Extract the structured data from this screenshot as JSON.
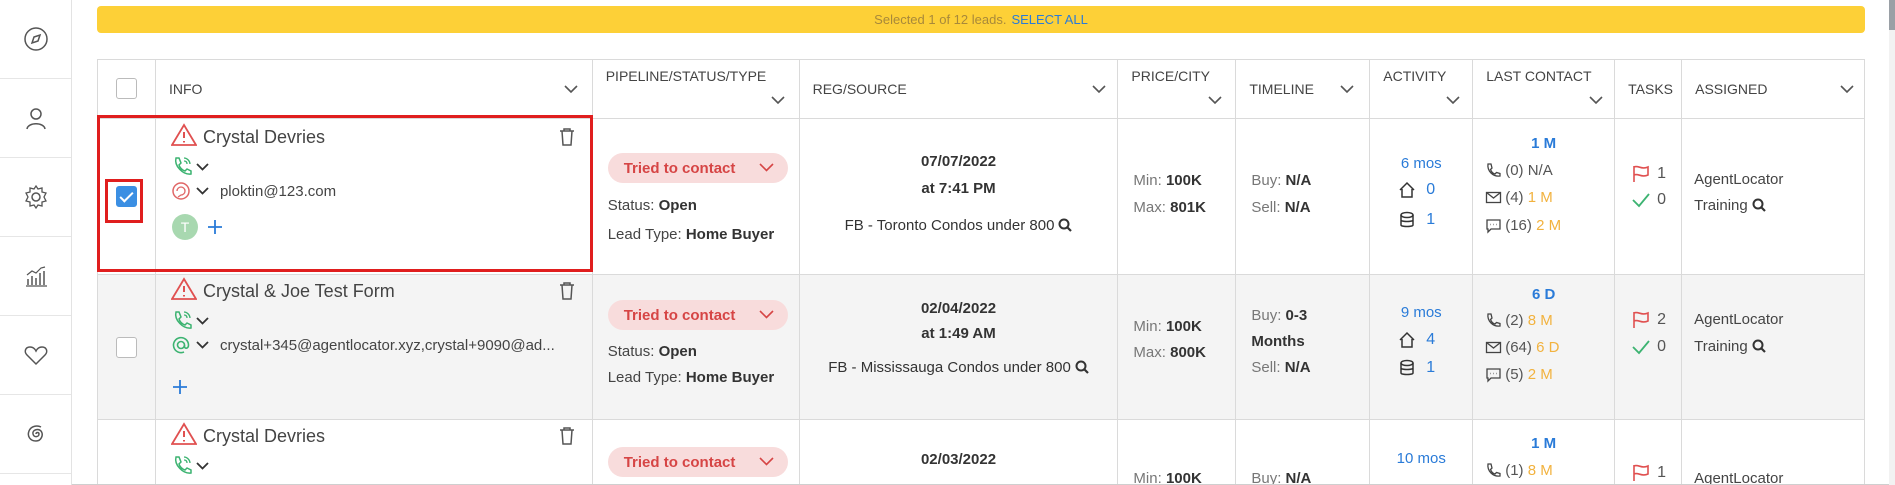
{
  "sidebar": {
    "items": [
      {
        "icon": "compass-icon"
      },
      {
        "icon": "user-icon"
      },
      {
        "icon": "gear-icon"
      },
      {
        "icon": "analytics-icon"
      },
      {
        "icon": "heart-icon"
      },
      {
        "icon": "spiral-icon"
      }
    ]
  },
  "selection": {
    "text": "Selected 1 of 12 leads.",
    "select_all": "SELECT ALL"
  },
  "columns": {
    "info": "INFO",
    "pipeline": "PIPELINE/STATUS/TYPE",
    "reg": "REG/SOURCE",
    "price": "PRICE/CITY",
    "timeline": "TIMELINE",
    "activity": "ACTIVITY",
    "last_contact": "LAST CONTACT",
    "tasks": "TASKS",
    "assigned": "ASSIGNED"
  },
  "labels": {
    "status": "Status:",
    "lead_type": "Lead Type:",
    "min": "Min:",
    "max": "Max:",
    "buy": "Buy:",
    "sell": "Sell:"
  },
  "rows": [
    {
      "selected": true,
      "name": "Crystal Devries",
      "email": "ploktin@123.com",
      "avatar": "T",
      "pipeline": "Tried to contact",
      "status": "Open",
      "lead_type": "Home Buyer",
      "reg_date": "07/07/2022",
      "reg_time": "at 7:41 PM",
      "source": "FB - Toronto Condos under 800",
      "min": "100K",
      "max": "801K",
      "buy": "N/A",
      "sell": "N/A",
      "activity_time": "6 mos",
      "activity_homes": "0",
      "activity_db": "1",
      "lc_top": "1 M",
      "lc_calls": "(0) N/A",
      "lc_calls_time": "",
      "lc_emails": "(4)",
      "lc_emails_time": "1 M",
      "lc_msgs": "(16)",
      "lc_msgs_time": "2 M",
      "tasks_flag": "1",
      "tasks_done": "0",
      "assigned_1": "AgentLocator",
      "assigned_2": "Training"
    },
    {
      "selected": false,
      "name": "Crystal & Joe Test Form",
      "email": "crystal+345@agentlocator.xyz,crystal+9090@ad...",
      "pipeline": "Tried to contact",
      "status": "Open",
      "lead_type": "Home Buyer",
      "reg_date": "02/04/2022",
      "reg_time": "at 1:49 AM",
      "source": "FB - Mississauga Condos under 800",
      "min": "100K",
      "max": "800K",
      "buy": "0-3",
      "buy_2": "Months",
      "sell": "N/A",
      "activity_time": "9 mos",
      "activity_homes": "4",
      "activity_db": "1",
      "lc_top": "6 D",
      "lc_calls": "(2)",
      "lc_calls_time": "8 M",
      "lc_emails": "(64)",
      "lc_emails_time": "6 D",
      "lc_msgs": "(5)",
      "lc_msgs_time": "2 M",
      "tasks_flag": "2",
      "tasks_done": "0",
      "assigned_1": "AgentLocator",
      "assigned_2": "Training"
    },
    {
      "selected": false,
      "name": "Crystal Devries",
      "pipeline": "Tried to contact",
      "reg_date": "02/03/2022",
      "min": "100K",
      "buy": "N/A",
      "activity_time": "10 mos",
      "lc_top": "1 M",
      "lc_calls": "(1)",
      "lc_calls_time": "8 M",
      "tasks_flag": "1",
      "assigned_1": "AgentLocator"
    }
  ],
  "colors": {
    "selection_bar": "#fdd037",
    "link_blue": "#2a7bd8",
    "pill_bg": "#f8dcdc",
    "pill_text": "#d64545",
    "amber": "#f2b23e",
    "highlight": "#e01e1e"
  }
}
